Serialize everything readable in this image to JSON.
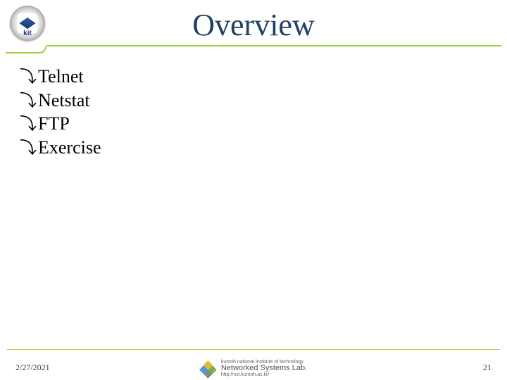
{
  "title": "Overview",
  "logo_text": "kit",
  "bullets": {
    "glyph": "⤵",
    "items": [
      "Telnet",
      "Netstat",
      "FTP",
      "Exercise"
    ]
  },
  "footer": {
    "date": "2/27/2021",
    "page": "21",
    "institute": "kumoh national institute of technology",
    "lab": "Networked Systems Lab.",
    "url": "http://nsl.kumoh.ac.kr/"
  }
}
